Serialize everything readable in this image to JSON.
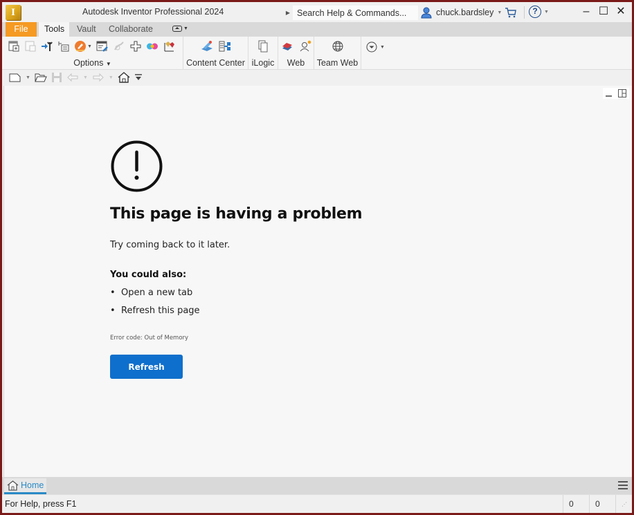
{
  "window": {
    "app_logo_letter": "I",
    "title": "Autodesk Inventor Professional 2024",
    "search": {
      "placeholder": "Search Help & Commands..."
    },
    "user": {
      "name": "chuck.bardsley"
    },
    "controls": {
      "minimize": "–",
      "maximize": "☐",
      "close": "✕"
    }
  },
  "ribbon_tabs": [
    {
      "label": "File",
      "active": false
    },
    {
      "label": "Tools",
      "active": true
    },
    {
      "label": "Vault",
      "active": false
    },
    {
      "label": "Collaborate",
      "active": false
    }
  ],
  "ribbon_groups": {
    "options": {
      "label": "Options"
    },
    "content_center": {
      "label": "Content Center"
    },
    "ilogic": {
      "label": "iLogic"
    },
    "web": {
      "label": "Web"
    },
    "team_web": {
      "label": "Team Web"
    }
  },
  "error_page": {
    "title": "This page is having a problem",
    "subtitle": "Try coming back to it later.",
    "also_heading": "You could also:",
    "suggestions": [
      "Open a new tab",
      "Refresh this page"
    ],
    "error_code": "Error code: Out of Memory",
    "refresh_label": "Refresh"
  },
  "doc_tabs": [
    {
      "label": "Home",
      "active": true
    }
  ],
  "status": {
    "help_text": "For Help, press F1",
    "count1": "0",
    "count2": "0"
  },
  "colors": {
    "file_tab": "#f59a23",
    "accent_blue": "#0f6fcc",
    "home_tab": "#2a8ac6",
    "window_border": "#7a1a18"
  }
}
